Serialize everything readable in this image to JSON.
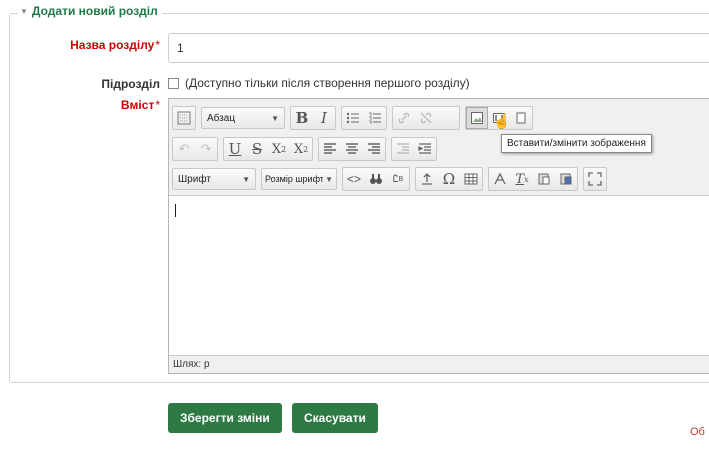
{
  "section": {
    "legend": "Додати новий розділ",
    "name_label": "Назва розділу",
    "name_value": "1",
    "subsection_label": "Підрозділ",
    "subsection_hint": "(Доступно тільки після створення першого розділу)",
    "content_label": "Вміст",
    "required_star": "*"
  },
  "editor": {
    "format_combo": "Абзац",
    "font_combo": "Шрифт",
    "size_combo": "Розмір шрифту",
    "tooltip": "Вставити/змінити зображення",
    "path_label": "Шлях: p"
  },
  "actions": {
    "save_label": "Зберегти зміни",
    "cancel_label": "Скасувати"
  },
  "edge_text": "Об"
}
